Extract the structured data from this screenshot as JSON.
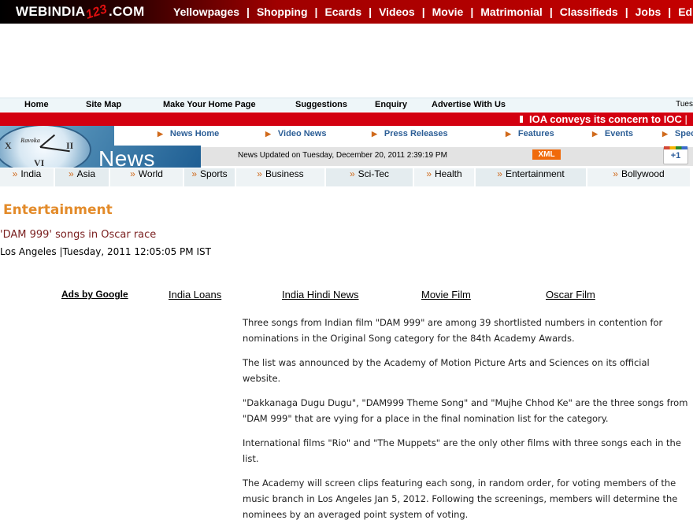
{
  "brand": {
    "prefix": "WEBINDIA",
    "number": "123",
    "suffix": ".COM"
  },
  "top_nav": [
    "Yellowpages",
    "Shopping",
    "Ecards",
    "Videos",
    "Movie",
    "Matrimonial",
    "Classifieds",
    "Jobs",
    "Ed"
  ],
  "utility_links": [
    "Home",
    "Site Map",
    "Make Your Home Page",
    "Suggestions",
    "Enquiry",
    "Advertise With Us"
  ],
  "utility_date_fragment": "Tues",
  "ticker": {
    "headline": "IOA conveys its concern to IOC"
  },
  "news_banner": {
    "clock_brand": "Ravoka",
    "title": "News"
  },
  "sub_nav": [
    "News Home",
    "Video News",
    "Press Releases",
    "Features",
    "Events",
    "Spec"
  ],
  "updated": {
    "text": "News Updated on Tuesday, December 20, 2011 2:39:19 PM",
    "xml_label": "XML",
    "gplus_label": "+1"
  },
  "sections": [
    "India",
    "Asia",
    "World",
    "Sports",
    "Business",
    "Sci-Tec",
    "Health",
    "Entertainment",
    "Bollywood"
  ],
  "section_title": "Entertainment",
  "article": {
    "headline": "'DAM 999' songs in Oscar race",
    "dateline": "Los Angeles |Tuesday, 2011 12:05:05 PM IST",
    "paragraphs": [
      "Three songs from Indian film \"DAM 999\" are among 39 shortlisted numbers in contention for nominations in the Original Song category for the 84th Academy Awards.",
      "The list was announced by the Academy of Motion Picture Arts and Sciences on its official website.",
      "\"Dakkanaga Dugu Dugu\", \"DAM999 Theme Song\" and \"Mujhe Chhod Ke\" are the three songs from \"DAM 999\" that are vying for a place in the final nomination list for the category.",
      "International films \"Rio\" and \"The Muppets\" are the only other films with three songs each in the list.",
      "The Academy will screen clips featuring each song, in random order, for voting members of the music branch in Los Angeles Jan 5, 2012. Following the screenings, members will determine the nominees by an averaged point system of voting."
    ]
  },
  "ads": {
    "label": "Ads by Google",
    "links": [
      "India Loans",
      "India Hindi News",
      "Movie Film",
      "Oscar Film"
    ]
  },
  "colors": {
    "brand_red": "#c40000",
    "ticker_red": "#d30010",
    "section_orange": "#e38b2a",
    "headline_maroon": "#7a1f1f",
    "link_blue": "#2c5e96"
  }
}
